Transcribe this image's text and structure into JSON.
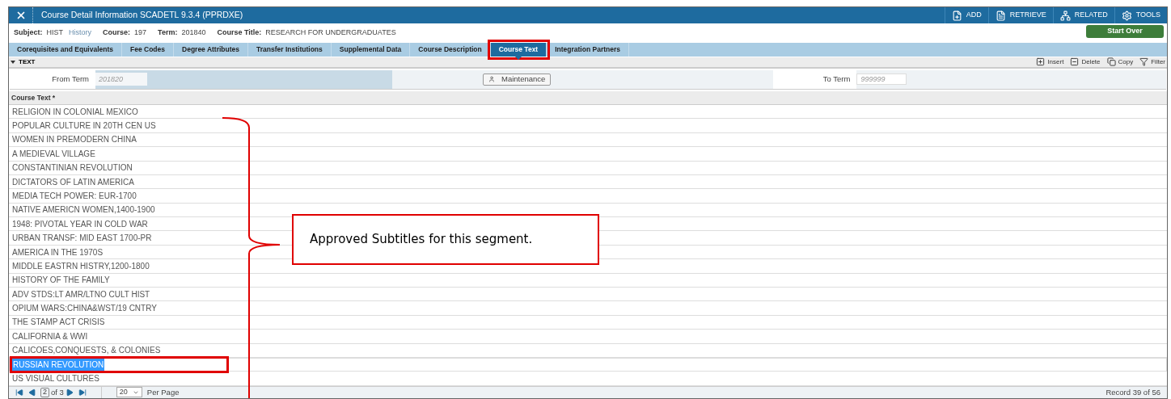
{
  "window": {
    "title": "Course Detail Information SCADETL 9.3.4 (PPRDXE)"
  },
  "toolbar": [
    {
      "kind": "add",
      "label": "ADD"
    },
    {
      "kind": "retrieve",
      "label": "RETRIEVE"
    },
    {
      "kind": "related",
      "label": "RELATED"
    },
    {
      "kind": "tools",
      "label": "TOOLS"
    }
  ],
  "key_fields": [
    {
      "label": "Subject:",
      "value": "HIST",
      "description": "History"
    },
    {
      "label": "Course:",
      "value": "197"
    },
    {
      "label": "Term:",
      "value": "201840"
    },
    {
      "label": "Course Title:",
      "value": "RESEARCH FOR UNDERGRADUATES"
    }
  ],
  "start_over": "Start Over",
  "tabs": [
    {
      "label": "Corequisites and Equivalents",
      "selected": false,
      "highlighted": false
    },
    {
      "label": "Fee Codes",
      "selected": false,
      "highlighted": false
    },
    {
      "label": "Degree Attributes",
      "selected": false,
      "highlighted": false
    },
    {
      "label": "Transfer Institutions",
      "selected": false,
      "highlighted": false
    },
    {
      "label": "Supplemental Data",
      "selected": false,
      "highlighted": false
    },
    {
      "label": "Course Description",
      "selected": false,
      "highlighted": false
    },
    {
      "label": "Course Text",
      "selected": true,
      "highlighted": true
    },
    {
      "label": "Integration Partners",
      "selected": false,
      "highlighted": false
    }
  ],
  "section": {
    "title": "TEXT",
    "expanded": true,
    "actions": [
      {
        "kind": "insert",
        "label": "Insert"
      },
      {
        "kind": "delete",
        "label": "Delete"
      },
      {
        "kind": "copy",
        "label": "Copy"
      },
      {
        "kind": "filter",
        "label": "Filter"
      }
    ]
  },
  "form": {
    "from_term": {
      "label": "From Term",
      "placeholder": "201820"
    },
    "maintenance": "Maintenance",
    "to_term": {
      "label": "To Term",
      "placeholder": "999999"
    }
  },
  "grid": {
    "column": "Course Text *",
    "rows": [
      {
        "text": "RELIGION IN COLONIAL MEXICO",
        "selected": false,
        "highlighted": false
      },
      {
        "text": "POPULAR CULTURE IN 20TH CEN US",
        "selected": false,
        "highlighted": false
      },
      {
        "text": "WOMEN IN PREMODERN CHINA",
        "selected": false,
        "highlighted": false
      },
      {
        "text": "A MEDIEVAL VILLAGE",
        "selected": false,
        "highlighted": false
      },
      {
        "text": "CONSTANTINIAN REVOLUTION",
        "selected": false,
        "highlighted": false
      },
      {
        "text": "DICTATORS OF LATIN AMERICA",
        "selected": false,
        "highlighted": false
      },
      {
        "text": "MEDIA TECH POWER: EUR-1700",
        "selected": false,
        "highlighted": false
      },
      {
        "text": "NATIVE AMERICN WOMEN,1400-1900",
        "selected": false,
        "highlighted": false
      },
      {
        "text": "1948: PIVOTAL YEAR IN COLD WAR",
        "selected": false,
        "highlighted": false
      },
      {
        "text": "URBAN TRANSF: MID EAST 1700-PR",
        "selected": false,
        "highlighted": false
      },
      {
        "text": "AMERICA IN THE 1970S",
        "selected": false,
        "highlighted": false
      },
      {
        "text": "MIDDLE EASTRN HISTRY,1200-1800",
        "selected": false,
        "highlighted": false
      },
      {
        "text": "HISTORY OF THE FAMILY",
        "selected": false,
        "highlighted": false
      },
      {
        "text": "ADV STDS:LT AMR/LTNO CULT HIST",
        "selected": false,
        "highlighted": false
      },
      {
        "text": "OPIUM WARS:CHINA&WST/19 CNTRY",
        "selected": false,
        "highlighted": false
      },
      {
        "text": "THE STAMP ACT CRISIS",
        "selected": false,
        "highlighted": false
      },
      {
        "text": "CALIFORNIA & WWI",
        "selected": false,
        "highlighted": false
      },
      {
        "text": "CALICOES,CONQUESTS, & COLONIES",
        "selected": false,
        "highlighted": false
      },
      {
        "text": "RUSSIAN REVOLUTION",
        "selected": true,
        "highlighted": true
      },
      {
        "text": "US VISUAL CULTURES",
        "selected": false,
        "highlighted": false
      }
    ]
  },
  "pagination": {
    "page": "2",
    "of": "of 3",
    "per_page": "20",
    "per_page_label": "Per Page",
    "record": "Record 39 of 56"
  },
  "annotation": {
    "text": "Approved Subtitles for this segment."
  }
}
